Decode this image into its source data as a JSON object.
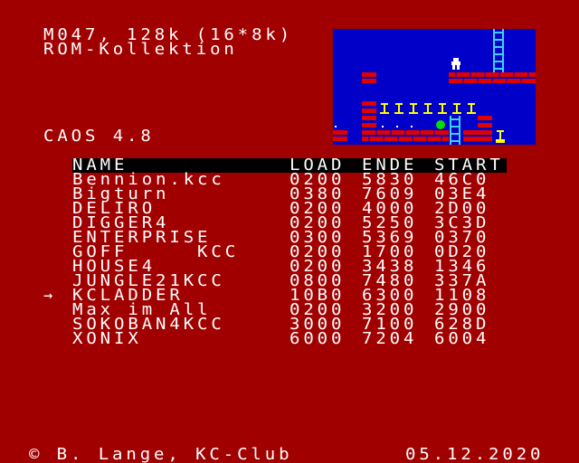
{
  "header": {
    "line1": "M047, 128k (16*8k)",
    "line2": "ROM-Kollektion"
  },
  "system": {
    "caos_label": "CAOS 4.8"
  },
  "table": {
    "columns": [
      "NAME",
      "LOAD",
      "ENDE",
      "START"
    ],
    "rows": [
      {
        "name": "Bennion.kcc",
        "load": "0200",
        "ende": "5830",
        "start": "46C0"
      },
      {
        "name": "Bigturn",
        "load": "0380",
        "ende": "7609",
        "start": "03E4"
      },
      {
        "name": "DELIRO",
        "load": "0200",
        "ende": "4000",
        "start": "2D00"
      },
      {
        "name": "DIGGER4",
        "load": "0200",
        "ende": "5250",
        "start": "3C3D"
      },
      {
        "name": "ENTERPRISE",
        "load": "0300",
        "ende": "5369",
        "start": "0370"
      },
      {
        "name": "GOFF     KCC",
        "load": "0200",
        "ende": "1700",
        "start": "0D20"
      },
      {
        "name": "HOUSE4",
        "load": "0200",
        "ende": "3438",
        "start": "1346"
      },
      {
        "name": "JUNGLE21KCC",
        "load": "0800",
        "ende": "7480",
        "start": "337A"
      },
      {
        "name": "KCLADDER",
        "load": "10B0",
        "ende": "6300",
        "start": "1108"
      },
      {
        "name": "Max im All",
        "load": "0200",
        "ende": "3200",
        "start": "2900"
      },
      {
        "name": "SOKOBAN4KCC",
        "load": "3000",
        "ende": "7100",
        "start": "628D"
      },
      {
        "name": "XONIX",
        "load": "6000",
        "ende": "7204",
        "start": "6004"
      }
    ],
    "selected_index": 8,
    "cursor_symbol": "→"
  },
  "footer": {
    "left": "© B. Lange, KC-Club",
    "right": "05.12.2020"
  },
  "preview": {
    "game": "KCLADDER",
    "colors": {
      "background": "#0000c8",
      "brick": "#e00000",
      "ladder": "#40d0ff",
      "item": "#ffff00",
      "ball": "#00e000",
      "player": "#ffffff"
    }
  },
  "colors": {
    "screen_bg": "#a00000",
    "text": "#ffffff",
    "header_bar": "#000000"
  }
}
